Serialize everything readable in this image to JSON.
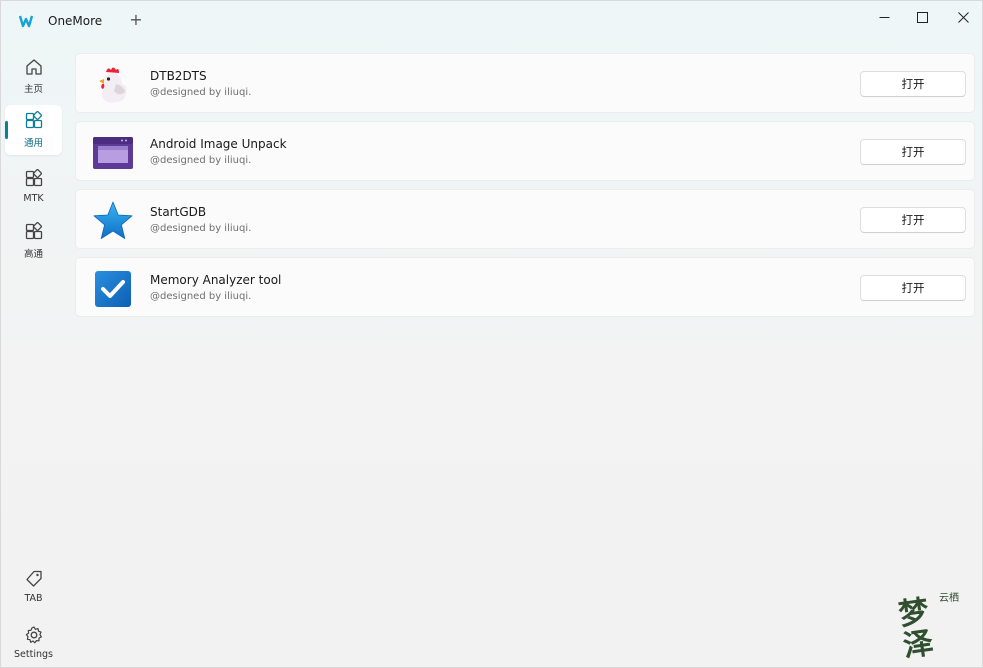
{
  "window": {
    "title": "OneMore",
    "new_tab_glyph": "+",
    "accent": "#0b7f95"
  },
  "sidebar": {
    "items": [
      {
        "label": "主页",
        "icon": "home-icon"
      },
      {
        "label": "通用",
        "icon": "apps-icon",
        "active": true
      },
      {
        "label": "MTK",
        "icon": "apps-icon"
      },
      {
        "label": "高通",
        "icon": "apps-icon"
      }
    ],
    "bottom": [
      {
        "label": "TAB",
        "icon": "tag-icon"
      },
      {
        "label": "Settings",
        "icon": "gear-icon"
      }
    ]
  },
  "tools": [
    {
      "name": "DTB2DTS",
      "author": "@designed by iliuqi.",
      "button": "打开",
      "icon": "chicken-icon"
    },
    {
      "name": "Android Image Unpack",
      "author": "@designed by iliuqi.",
      "button": "打开",
      "icon": "window-icon"
    },
    {
      "name": "StartGDB",
      "author": "@designed by iliuqi.",
      "button": "打开",
      "icon": "star-icon"
    },
    {
      "name": "Memory Analyzer tool",
      "author": "@designed by iliuqi.",
      "button": "打开",
      "icon": "checkbox-icon"
    }
  ],
  "watermark": {
    "big_text": "梦泽",
    "small_text": "云栖"
  }
}
